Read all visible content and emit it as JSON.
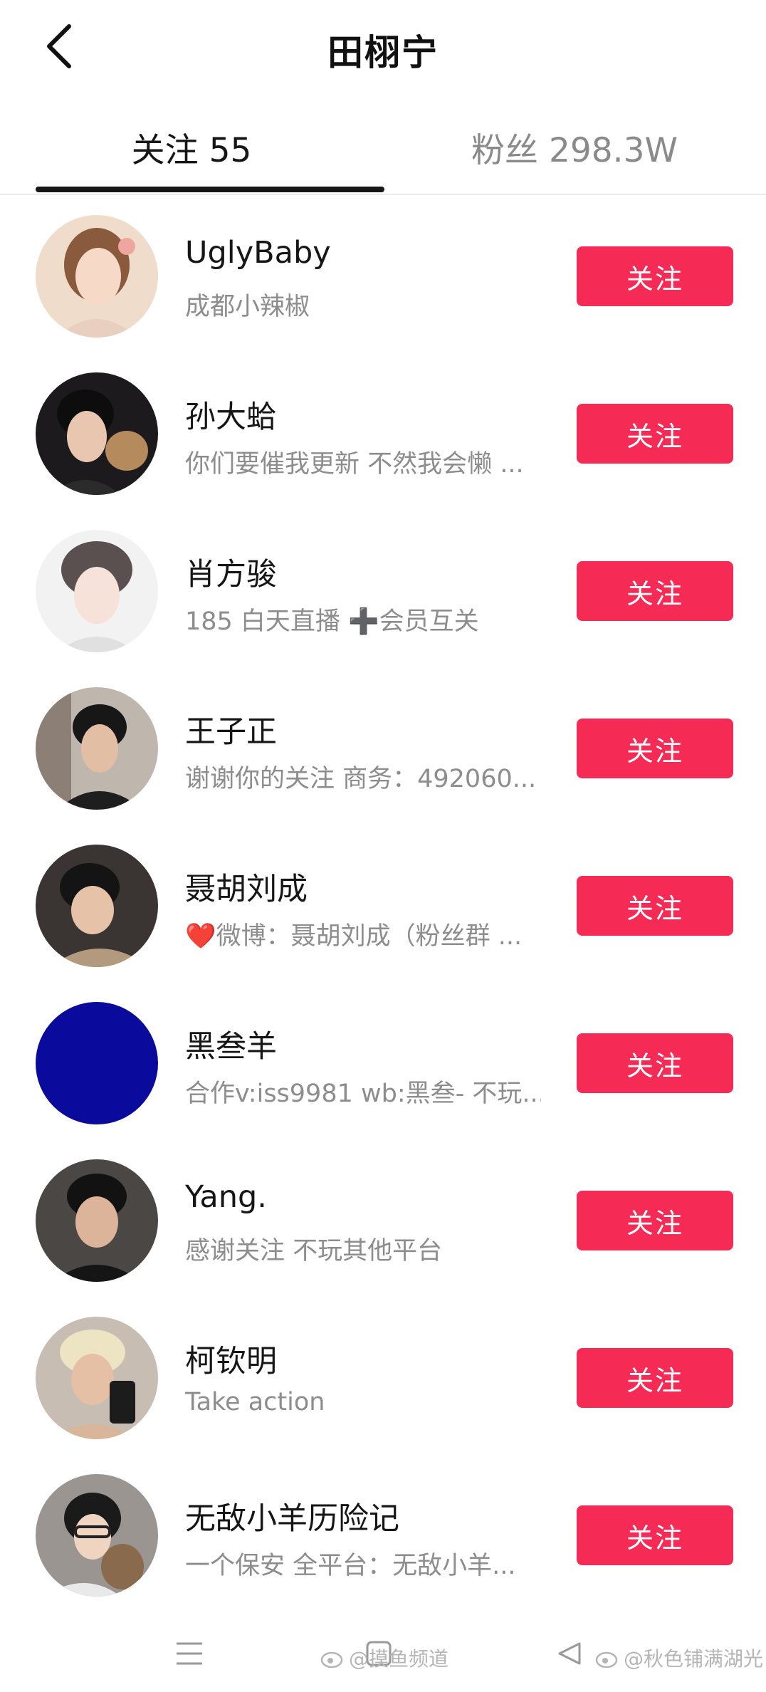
{
  "header": {
    "title": "田栩宁",
    "back_icon": "chevron-left-icon"
  },
  "tabs": [
    {
      "label": "关注 55",
      "active": true
    },
    {
      "label": "粉丝 298.3W",
      "active": false
    }
  ],
  "colors": {
    "accent": "#f52a55",
    "text_primary": "#161616",
    "text_secondary": "#8d8d8d"
  },
  "users": [
    {
      "name": "UglyBaby",
      "desc": "成都小辣椒",
      "button": "关注"
    },
    {
      "name": "孙大蛤",
      "desc": "你们要催我更新 不然我会懒 ...",
      "button": "关注"
    },
    {
      "name": "肖方骏",
      "desc": "185 白天直播 ➕会员互关",
      "button": "关注"
    },
    {
      "name": "王子正",
      "desc": "谢谢你的关注 商务：492060...",
      "button": "关注"
    },
    {
      "name": "聂胡刘成",
      "desc": "❤️微博：聂胡刘成（粉丝群 ...",
      "button": "关注"
    },
    {
      "name": "黑叁羊",
      "desc": "合作v:iss9981 wb:黑叁- 不玩...",
      "button": "关注"
    },
    {
      "name": "Yang.",
      "desc": "感谢关注 不玩其他平台",
      "button": "关注"
    },
    {
      "name": "柯钦明",
      "desc": "Take action",
      "button": "关注"
    },
    {
      "name": "无敌小羊历险记",
      "desc": "一个保安 全平台：无敌小羊...",
      "button": "关注"
    }
  ],
  "nav_bar": {
    "menu_icon": "menu-icon",
    "home_icon": "home-square-icon",
    "back_icon": "back-triangle-icon"
  },
  "watermarks": [
    "@摸鱼频道",
    "@秋色铺满湖光"
  ]
}
